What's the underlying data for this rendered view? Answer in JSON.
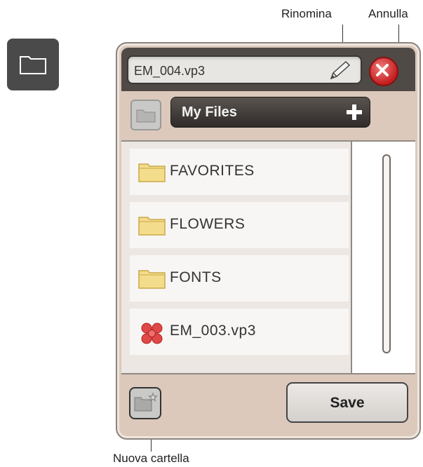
{
  "callouts": {
    "rename": "Rinomina",
    "cancel": "Annulla",
    "new_folder": "Nuova cartella"
  },
  "dialog": {
    "filename": "EM_004.vp3",
    "current_folder": "My Files",
    "save_label": "Save"
  },
  "files": [
    {
      "label": "FAVORITES",
      "icon": "folder-icon"
    },
    {
      "label": "FLOWERS",
      "icon": "folder-icon"
    },
    {
      "label": "FONTS",
      "icon": "folder-icon"
    },
    {
      "label": "EM_003.vp3",
      "icon": "embroidery-file-icon"
    }
  ],
  "colors": {
    "dialog_bg": "#dcc9bc",
    "header_bg": "#4f4a46",
    "cancel_red": "#c41e1e",
    "folder_yellow": "#f3dc8b"
  }
}
